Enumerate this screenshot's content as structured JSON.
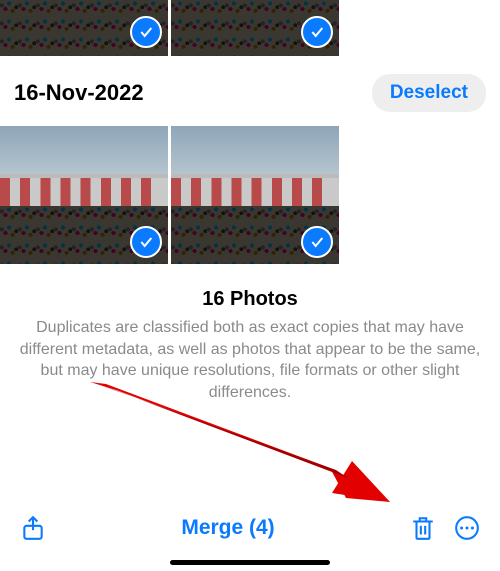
{
  "group1": {
    "date_label": "16-Nov-2022"
  },
  "controls": {
    "deselect": "Deselect"
  },
  "summary": {
    "title": "16 Photos",
    "body": "Duplicates are classified both as exact copies that may have different metadata, as well as photos that appear to be the same, but may have unique resolutions, file formats or other slight differences."
  },
  "toolbar": {
    "merge": "Merge (4)"
  }
}
